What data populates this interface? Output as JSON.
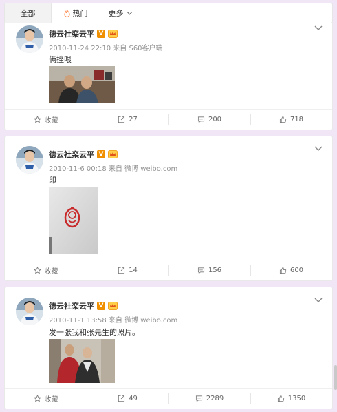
{
  "tabs": {
    "all": "全部",
    "hot": "热门",
    "more": "更多"
  },
  "colors": {
    "accent": "#f09000",
    "page_bg": "#f1e6f6",
    "hot_icon": "#ff8140"
  },
  "posts": [
    {
      "author": "德云社栾云平",
      "meta": "2010-11-24 22:10 来自 S60客户端",
      "text": "俩挫哏",
      "actions": {
        "favorite": "收藏",
        "repost": "27",
        "comment": "200",
        "like": "718"
      }
    },
    {
      "author": "德云社栾云平",
      "meta": "2010-11-6 00:18 来自 微博 weibo.com",
      "text": "印",
      "actions": {
        "favorite": "收藏",
        "repost": "14",
        "comment": "156",
        "like": "600"
      }
    },
    {
      "author": "德云社栾云平",
      "meta": "2010-11-1 13:58 来自 微博 weibo.com",
      "text": "发一张我和张先生的照片。",
      "actions": {
        "favorite": "收藏",
        "repost": "49",
        "comment": "2289",
        "like": "1350"
      }
    }
  ],
  "icons": {
    "hot": "flame-icon",
    "more": "chevron-down-icon",
    "favorite": "star-icon",
    "repost": "share-icon",
    "comment": "comment-icon",
    "like": "thumbs-up-icon",
    "verified": "verified-v-icon",
    "member": "crown-icon",
    "post_menu": "chevron-down-icon"
  }
}
